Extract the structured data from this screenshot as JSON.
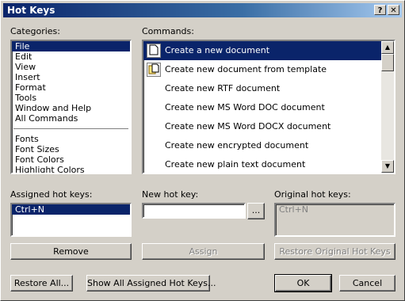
{
  "window": {
    "title": "Hot Keys",
    "help_glyph": "?",
    "close_glyph": "✕"
  },
  "categories": {
    "label": "Categories:",
    "group1": [
      "File",
      "Edit",
      "View",
      "Insert",
      "Format",
      "Tools",
      "Window and Help",
      "All Commands"
    ],
    "group2": [
      "Fonts",
      "Font Sizes",
      "Font Colors",
      "Highlight Colors"
    ],
    "selected": "File"
  },
  "commands": {
    "label": "Commands:",
    "items": [
      "Create a new document",
      "Create new document from template",
      "Create new RTF document",
      "Create new MS Word DOC document",
      "Create new MS Word DOCX document",
      "Create new encrypted document",
      "Create new plain text document"
    ],
    "selected": "Create a new document"
  },
  "assigned": {
    "label": "Assigned hot keys:",
    "items": [
      "Ctrl+N"
    ],
    "remove": "Remove"
  },
  "newkey": {
    "label": "New hot key:",
    "value": "",
    "browse": "...",
    "assign": "Assign"
  },
  "original": {
    "label": "Original hot keys:",
    "value": "Ctrl+N",
    "restore": "Restore Original Hot Keys"
  },
  "footer": {
    "restore_all": "Restore All...",
    "show_all": "Show All Assigned Hot Keys...",
    "ok": "OK",
    "cancel": "Cancel"
  }
}
